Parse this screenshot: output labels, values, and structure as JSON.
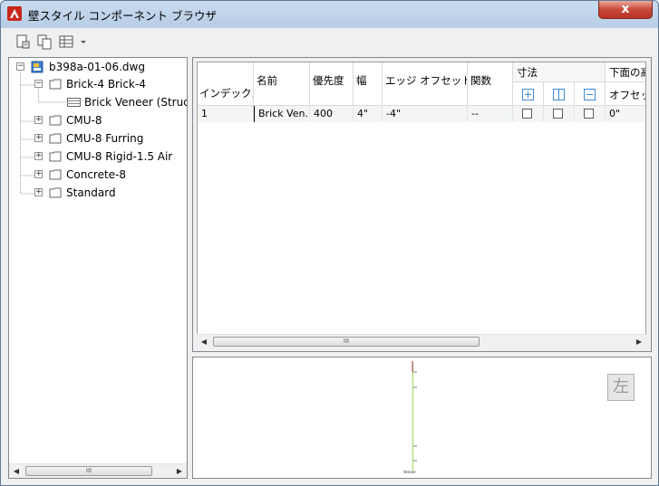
{
  "window": {
    "title": "壁スタイル コンポーネント ブラウザ",
    "close_glyph": "x"
  },
  "toolbar": {
    "icons": [
      "drawing-icon",
      "copy-icon",
      "view-table-icon",
      "dropdown-arrow-icon"
    ]
  },
  "tree": {
    "root": {
      "label": "b398a-01-06.dwg",
      "expander": "−"
    },
    "items": [
      {
        "label": "Brick-4 Brick-4",
        "expander": "−"
      },
      {
        "label": "Brick Veneer (Struc"
      },
      {
        "label": "CMU-8",
        "expander": "+"
      },
      {
        "label": "CMU-8 Furring",
        "expander": "+"
      },
      {
        "label": "CMU-8 Rigid-1.5 Air",
        "expander": "+"
      },
      {
        "label": "Concrete-8",
        "expander": "+"
      },
      {
        "label": "Standard",
        "expander": "+"
      }
    ],
    "scroll_thumb_glyph": "III"
  },
  "grid": {
    "headers": {
      "index": "インデックス",
      "name": "名前",
      "priority": "優先度",
      "width": "幅",
      "edge_offset": "エッジ オフセット",
      "function": "関数",
      "dimension": "寸法",
      "bottom": "下面の高",
      "offset": "オフセット"
    },
    "rows": [
      {
        "index": "1",
        "name": "Brick Ven...",
        "priority": "400",
        "width": "4\"",
        "edge_offset": "-4\"",
        "function": "--",
        "offset": "0\""
      }
    ],
    "scroll_thumb_glyph": "III"
  },
  "preview": {
    "side_button": "左",
    "labels": [
      "Veneer"
    ]
  },
  "colors": {
    "accent": "#3b8ad8",
    "preview_line": "#9bdc4b",
    "title_bar": "#c9dbef"
  }
}
